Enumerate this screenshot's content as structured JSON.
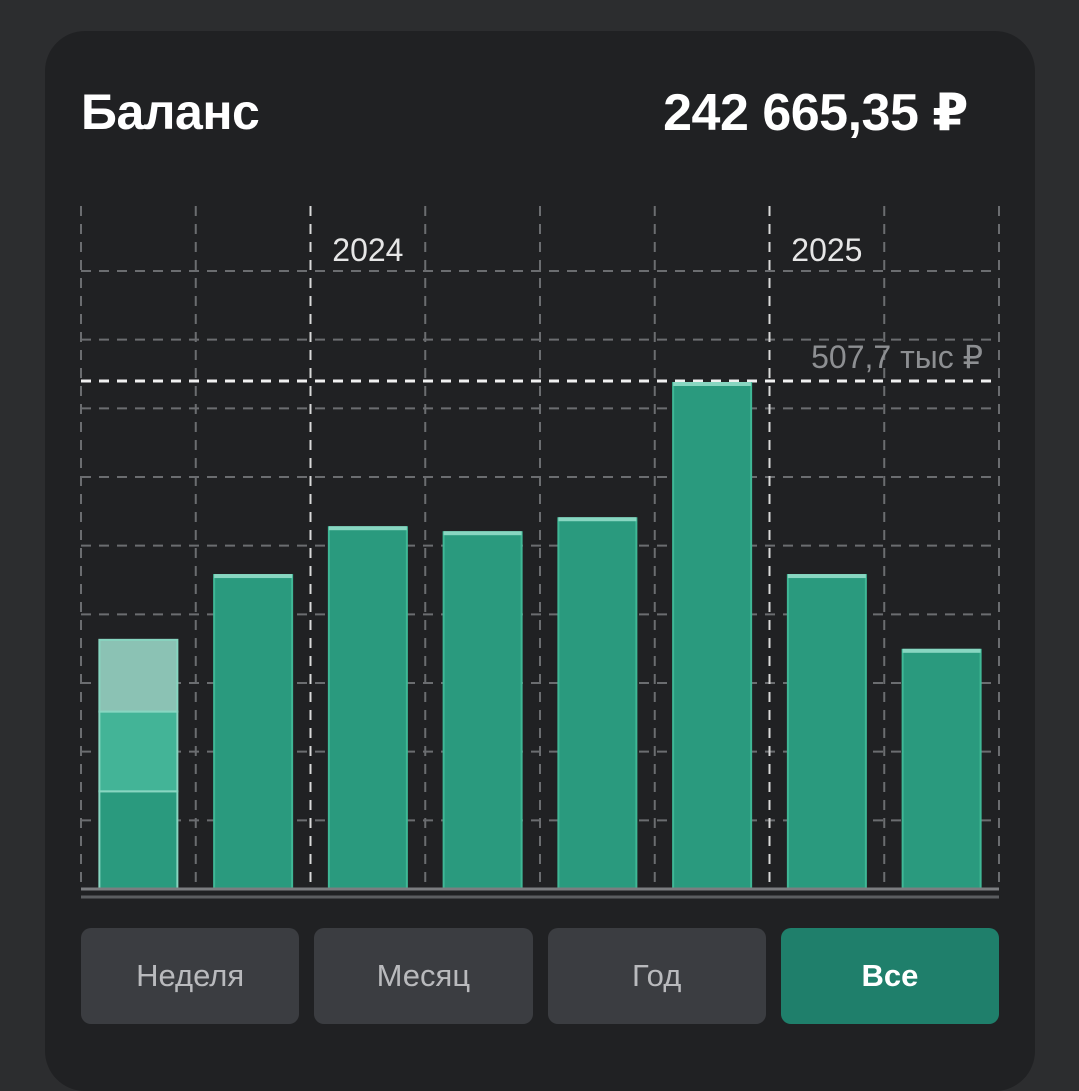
{
  "header": {
    "title": "Баланс",
    "amount": "242 665,35 ₽"
  },
  "periods": {
    "items": [
      {
        "label": "Неделя",
        "active": false
      },
      {
        "label": "Месяц",
        "active": false
      },
      {
        "label": "Год",
        "active": false
      },
      {
        "label": "Все",
        "active": true
      }
    ]
  },
  "colors": {
    "bar": "#2a9a7e",
    "bar_top": "#88d6c1",
    "bar_segment_mid": "#43b497",
    "bar_segment_light": "#8bc2b4",
    "active_button": "#1f7f6b",
    "card": "#202123",
    "background": "#2c2d2f"
  },
  "chart_data": {
    "type": "bar",
    "year_labels": [
      {
        "label": "2024",
        "position_index": 2.5
      },
      {
        "label": "2025",
        "position_index": 6.5
      }
    ],
    "max_label": "507,7 тыс ₽",
    "max_value": 507.7,
    "ylim": [
      0,
      600
    ],
    "grid": true,
    "series": [
      {
        "values": [
          250,
          315,
          363,
          358,
          372,
          507.7,
          315,
          240
        ]
      }
    ],
    "stacked_first_bar": [
      {
        "value": 98,
        "tone": "dark"
      },
      {
        "value": 80,
        "tone": "mid"
      },
      {
        "value": 72,
        "tone": "light"
      }
    ]
  }
}
